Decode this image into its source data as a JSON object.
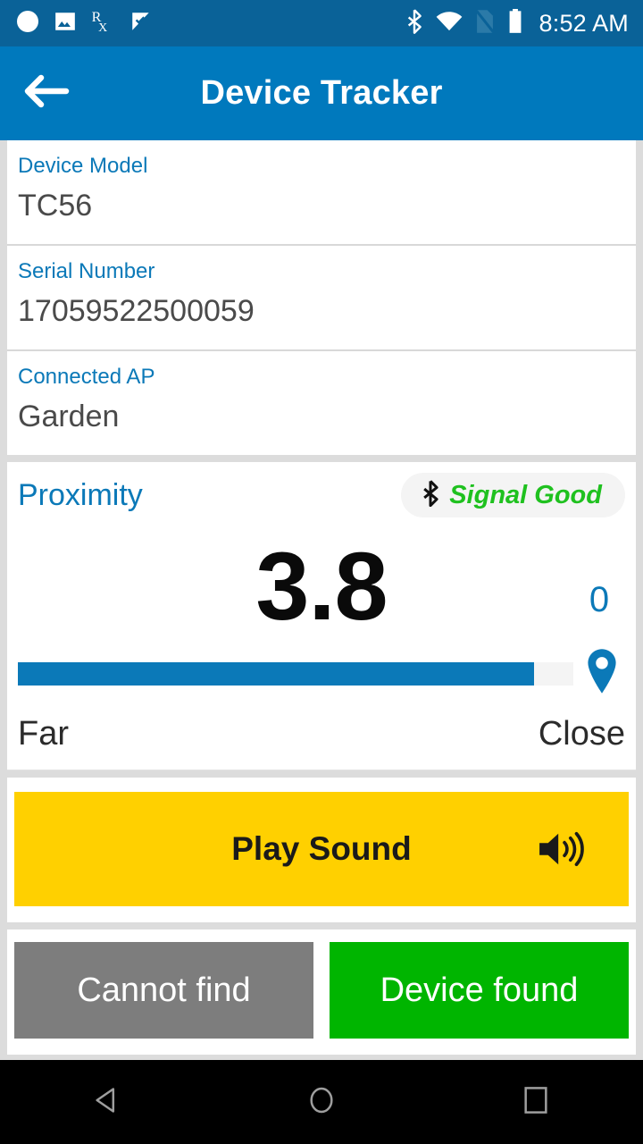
{
  "statusbar": {
    "time": "8:52 AM",
    "left_icons": [
      "circle-icon",
      "image-icon",
      "prescription-rx-icon",
      "check-flag-icon"
    ],
    "right_icons": [
      "bluetooth-icon",
      "wifi-icon",
      "sim-card-off-icon",
      "battery-icon"
    ]
  },
  "appbar": {
    "title": "Device Tracker",
    "back_icon": "back-arrow-icon"
  },
  "fields": [
    {
      "label": "Device Model",
      "value": "TC56"
    },
    {
      "label": "Serial Number",
      "value": "17059522500059"
    },
    {
      "label": "Connected AP",
      "value": "Garden"
    }
  ],
  "proximity": {
    "title": "Proximity",
    "signal_status": "Signal Good",
    "signal_icon": "bluetooth-icon",
    "value": "3.8",
    "bar_fill_percent": 93,
    "pin_count": "0",
    "pin_icon": "location-pin-icon",
    "scale_left": "Far",
    "scale_right": "Close"
  },
  "play_sound": {
    "label": "Play Sound",
    "icon": "speaker-volume-icon"
  },
  "actions": {
    "cannot_find": "Cannot find",
    "device_found": "Device found"
  },
  "navbar": {
    "back": "nav-back-icon",
    "home": "nav-home-icon",
    "recents": "nav-recents-icon"
  },
  "colors": {
    "statusbar": "#0a6298",
    "appbar": "#0079bd",
    "accent_blue": "#0b79b8",
    "signal_green": "#1fc11f",
    "play_yellow": "#ffd000",
    "cannot_gray": "#7d7d7d",
    "found_green": "#00b500",
    "page_bg": "#dcdcdc"
  }
}
